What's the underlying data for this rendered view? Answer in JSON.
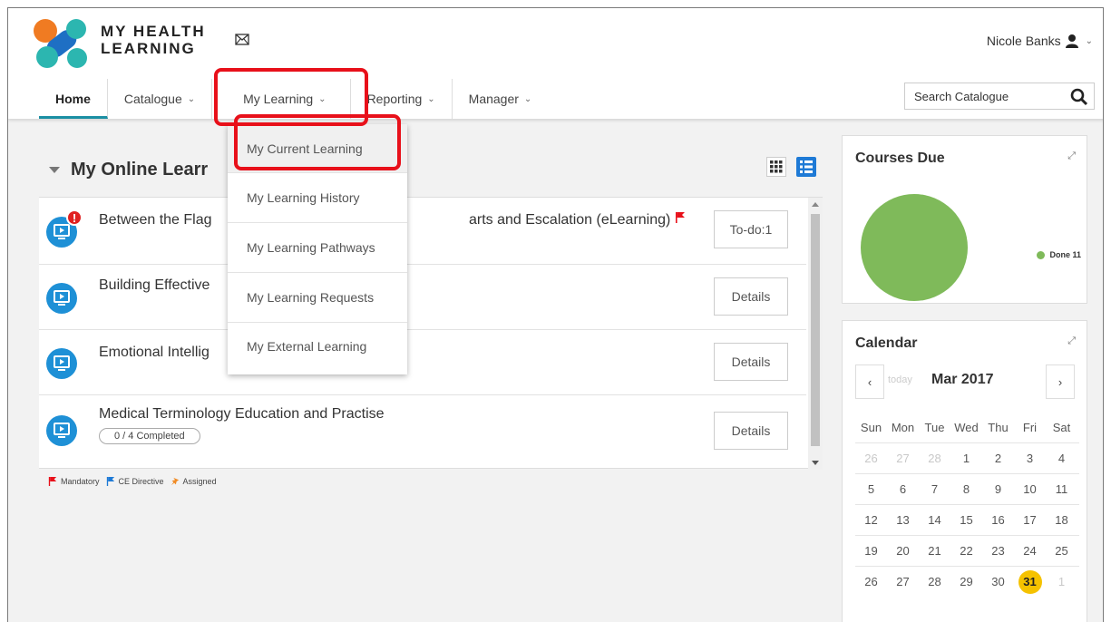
{
  "app": {
    "logo_line1": "MY HEALTH",
    "logo_line2": "LEARNING",
    "user_name": "Nicole Banks",
    "search_placeholder": "Search Catalogue"
  },
  "nav": [
    {
      "label": "Home",
      "active": true
    },
    {
      "label": "Catalogue",
      "has_menu": true
    },
    {
      "label": "My Learning",
      "has_menu": true
    },
    {
      "label": "Reporting",
      "has_menu": true
    },
    {
      "label": "Manager",
      "has_menu": true
    }
  ],
  "dropdown": {
    "items": [
      "My Current Learning",
      "My Learning History",
      "My Learning Pathways",
      "My Learning Requests",
      "My External Learning"
    ]
  },
  "panel": {
    "title": "My Online Learr",
    "courses": [
      {
        "title_left": "Between the Flag",
        "title_right": "arts and Escalation (eLearning)",
        "button": "To-do:1",
        "alert": "!",
        "mandatory": true
      },
      {
        "title_left": "Building Effective",
        "button": "Details"
      },
      {
        "title_left": "Emotional Intellig",
        "button": "Details"
      },
      {
        "title_left": "Medical Terminology Education and Practise",
        "button": "Details",
        "progress": "0 / 4 Completed"
      }
    ],
    "legend": {
      "mandatory": "Mandatory",
      "ce_directive": "CE Directive",
      "assigned": "Assigned"
    }
  },
  "courses_due": {
    "title": "Courses Due",
    "legend_label": "Done 11",
    "chart_data": {
      "type": "pie",
      "slices": [
        {
          "label": "Done",
          "value": 11
        }
      ]
    }
  },
  "calendar": {
    "title": "Calendar",
    "prev": "‹",
    "next": "›",
    "today_label": "today",
    "month": "Mar 2017",
    "weekdays": [
      "Sun",
      "Mon",
      "Tue",
      "Wed",
      "Thu",
      "Fri",
      "Sat"
    ],
    "weeks": [
      [
        "26",
        "27",
        "28",
        "1",
        "2",
        "3",
        "4"
      ],
      [
        "5",
        "6",
        "7",
        "8",
        "9",
        "10",
        "11"
      ],
      [
        "12",
        "13",
        "14",
        "15",
        "16",
        "17",
        "18"
      ],
      [
        "19",
        "20",
        "21",
        "22",
        "23",
        "24",
        "25"
      ],
      [
        "26",
        "27",
        "28",
        "29",
        "30",
        "31",
        "1"
      ]
    ],
    "today_day": "31"
  },
  "colors": {
    "accent": "#1b8fa3",
    "primary_blue": "#1e90d6",
    "highlight_red": "#e8101a",
    "done_green": "#7fba5a",
    "today_yellow": "#f5c200"
  }
}
